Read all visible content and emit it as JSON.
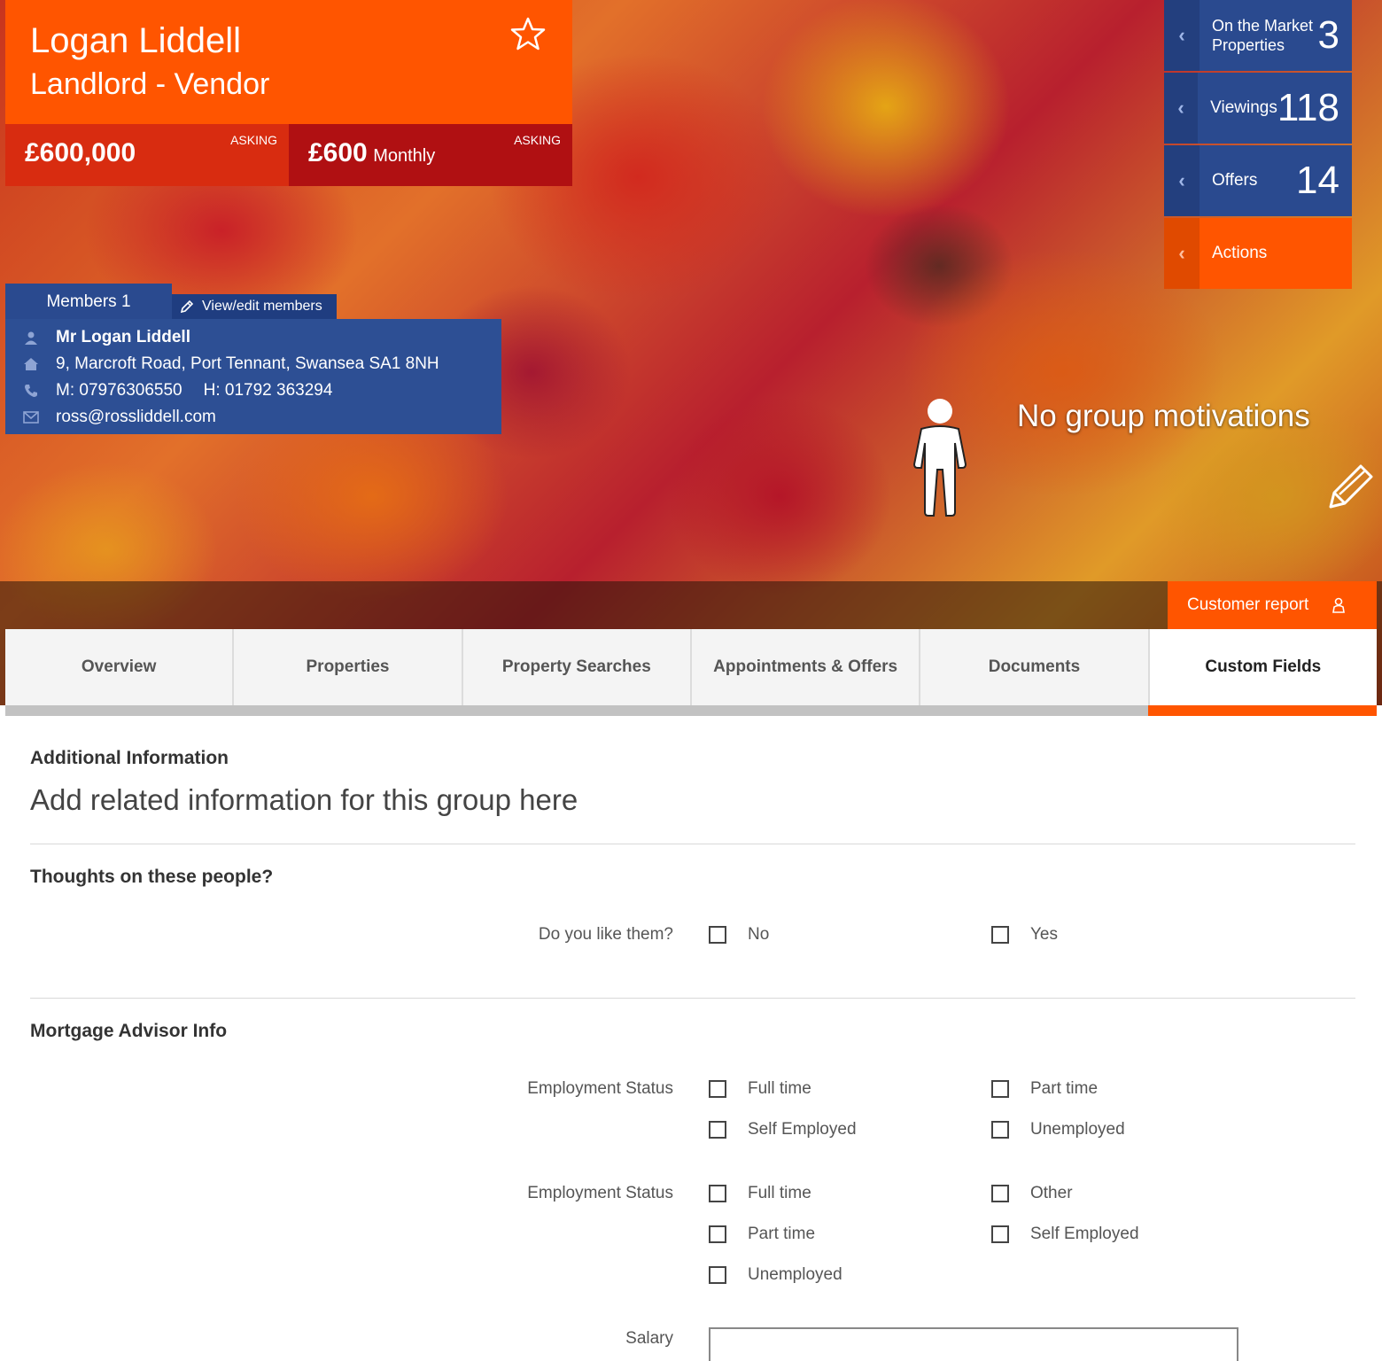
{
  "header": {
    "name": "Logan Liddell",
    "role": "Landlord - Vendor",
    "sale_price": "£600,000",
    "sale_tag": "ASKING",
    "let_price": "£600",
    "let_frequency": "Monthly",
    "let_tag": "ASKING"
  },
  "stats": {
    "on_market_label": "On the Market Properties",
    "on_market_value": "3",
    "viewings_label": "Viewings",
    "viewings_value": "118",
    "offers_label": "Offers",
    "offers_value": "14",
    "actions_label": "Actions"
  },
  "members": {
    "tab_label": "Members 1",
    "edit_label": "View/edit members",
    "name": "Mr Logan Liddell",
    "address": "9, Marcroft Road, Port Tennant, Swansea SA1 8NH",
    "mobile": "M: 07976306550",
    "home": "H: 01792 363294",
    "email": "ross@rossliddell.com"
  },
  "motivations": "No group motivations",
  "customer_report_label": "Customer report",
  "tabs": [
    "Overview",
    "Properties",
    "Property Searches",
    "Appointments & Offers",
    "Documents",
    "Custom Fields"
  ],
  "active_tab": "Custom Fields",
  "content": {
    "heading": "Additional Information",
    "subtitle": "Add related information for this group here",
    "section1": {
      "title": "Thoughts on these people?",
      "question": "Do you like them?",
      "options": [
        "No",
        "Yes"
      ]
    },
    "section2": {
      "title": "Mortgage Advisor Info",
      "group1_label": "Employment Status",
      "group1_options": [
        "Full time",
        "Part time",
        "Self Employed",
        "Unemployed"
      ],
      "group2_label": "Employment Status",
      "group2_options": [
        "Full time",
        "Other",
        "Part time",
        "Self Employed",
        "Unemployed"
      ],
      "salary_label": "Salary",
      "salary_value": ""
    }
  },
  "colors": {
    "accent": "#ff5500",
    "sale_red": "#d82c10",
    "let_red": "#b01012",
    "navy": "#2a4a8f"
  }
}
